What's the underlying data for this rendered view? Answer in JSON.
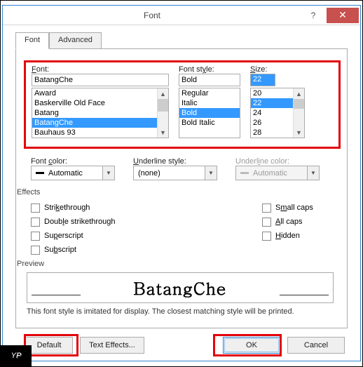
{
  "window": {
    "title": "Font"
  },
  "tabs": {
    "font": "Font",
    "advanced": "Advanced"
  },
  "labels": {
    "font": "Font:",
    "style": "Font style:",
    "size": "Size:",
    "fontcolor": "Font color:",
    "ulstyle": "Underline style:",
    "ulcolor": "Underline color:",
    "effects": "Effects",
    "preview": "Preview"
  },
  "inputs": {
    "font": "BatangChe",
    "style": "Bold",
    "size": "22"
  },
  "fontlist": [
    "Award",
    "Baskerville Old Face",
    "Batang",
    "BatangChe",
    "Bauhaus 93"
  ],
  "stylelist": [
    "Regular",
    "Italic",
    "Bold",
    "Bold Italic"
  ],
  "sizelist": [
    "20",
    "22",
    "24",
    "26",
    "28"
  ],
  "selects": {
    "fontcolor": "Automatic",
    "ulstyle": "(none)",
    "ulcolor": "Automatic"
  },
  "effectsLeft": [
    {
      "label": "Strikethrough",
      "u": "k"
    },
    {
      "label": "Double strikethrough",
      "u": "l"
    },
    {
      "label": "Superscript",
      "u": "p"
    },
    {
      "label": "Subscript",
      "u": "b"
    }
  ],
  "effectsRight": [
    {
      "label": "Small caps",
      "u": "m"
    },
    {
      "label": "All caps",
      "u": "A"
    },
    {
      "label": "Hidden",
      "u": "H"
    }
  ],
  "previewText": "BatangChe",
  "note": "This font style is imitated for display. The closest matching style will be printed.",
  "buttons": {
    "default": "Default",
    "texteffects": "Text Effects...",
    "ok": "OK",
    "cancel": "Cancel"
  }
}
